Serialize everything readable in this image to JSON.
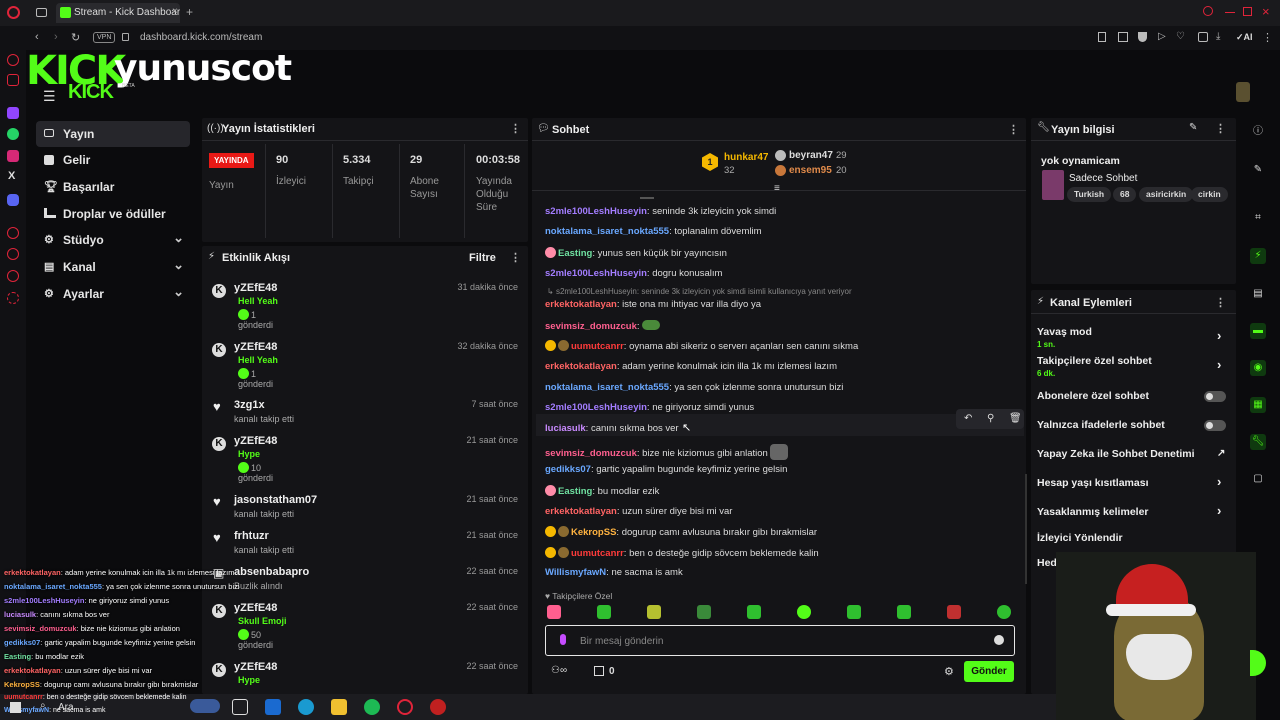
{
  "browser": {
    "tab_title": "Stream - Kick Dashboard",
    "url": "dashboard.kick.com/stream",
    "vpn": "VPN",
    "ai": "AI"
  },
  "header": {
    "logo": "KICK",
    "channel_name": "yunuscot",
    "sub_logo": "KICK",
    "beta": "BETA"
  },
  "nav": {
    "items": [
      {
        "label": "Yayın",
        "icon": "stream-icon"
      },
      {
        "label": "Gelir",
        "icon": "revenue-icon"
      },
      {
        "label": "Başarılar",
        "icon": "trophy-icon"
      },
      {
        "label": "Droplar ve ödüller",
        "icon": "drops-icon"
      },
      {
        "label": "Stüdyo",
        "icon": "studio-icon"
      },
      {
        "label": "Kanal",
        "icon": "channel-icon"
      },
      {
        "label": "Ayarlar",
        "icon": "settings-icon"
      }
    ]
  },
  "stats": {
    "title": "Yayın İstatistikleri",
    "status_badge": "YAYINDA",
    "status_label": "Yayın",
    "viewers": "90",
    "viewers_label": "İzleyici",
    "followers": "5.334",
    "followers_label": "Takipçi",
    "subs": "29",
    "subs_label1": "Abone",
    "subs_label2": "Sayısı",
    "uptime": "00:03:58",
    "uptime_label1": "Yayında",
    "uptime_label2": "Olduğu",
    "uptime_label3": "Süre"
  },
  "activity": {
    "title": "Etkinlik Akışı",
    "filter": "Filtre",
    "items": [
      {
        "user": "yZEfE48",
        "time": "31 dakika önce",
        "line1": "Hell Yeah",
        "count": "1",
        "line2": "gönderdi"
      },
      {
        "user": "yZEfE48",
        "time": "32 dakika önce",
        "line1": "Hell Yeah",
        "count": "1",
        "line2": "gönderdi"
      },
      {
        "user": "3zg1x",
        "time": "7 saat önce",
        "line2": "kanalı takip etti"
      },
      {
        "user": "yZEfE48",
        "time": "21 saat önce",
        "line1": "Hype",
        "count": "10",
        "line2": "gönderdi"
      },
      {
        "user": "jasonstatham07",
        "time": "21 saat önce",
        "line2": "kanalı takip etti"
      },
      {
        "user": "frhtuzr",
        "time": "21 saat önce",
        "line2": "kanalı takip etti"
      },
      {
        "user": "absenbabapro",
        "time": "22 saat önce",
        "line2": "Buzlik alındı"
      },
      {
        "user": "yZEfE48",
        "time": "22 saat önce",
        "line1": "Skull Emoji",
        "count": "50",
        "line2": "gönderdi"
      },
      {
        "user": "yZEfE48",
        "time": "22 saat önce",
        "line1": "Hype"
      }
    ]
  },
  "chat": {
    "title": "Sohbet",
    "top": [
      {
        "rank": "1",
        "user": "hunkar47",
        "count": "32"
      },
      {
        "user": "beyran47",
        "count": "29"
      },
      {
        "user": "ensem95",
        "count": "20"
      }
    ],
    "reply_note": "s2mle100LeshHuseyin: seninde 3k izleyicin yok simdi isimli kullanıcıya yanıt veriyor",
    "messages": [
      {
        "user": "s2mle100LeshHuseyin",
        "color": "#a37dff",
        "text": "seninde 3k izleyicin yok simdi"
      },
      {
        "user": "noktalama_isaret_nokta555",
        "color": "#6aa8ff",
        "text": "toplanalım dövemlim"
      },
      {
        "user": "Easting",
        "color": "#6fe0a0",
        "text": "yunus sen küçük bir yayıncısın"
      },
      {
        "user": "s2mle100LeshHuseyin",
        "color": "#a37dff",
        "text": "dogru konusalım"
      },
      {
        "user": "erkektokatlayan",
        "color": "#ff6464",
        "text": "iste ona mı ihtiyac var illa diyo ya"
      },
      {
        "user": "sevimsiz_domuzcuk",
        "color": "#ff5f8f",
        "text": ""
      },
      {
        "user": "uumutcanrr",
        "color": "#ff3b3b",
        "text": "oynama abi sikeriz o serverı açanları sen canını sıkma"
      },
      {
        "user": "erkektokatlayan",
        "color": "#ff6464",
        "text": "adam yerine konulmak icin illa 1k mı izlemesi lazım"
      },
      {
        "user": "noktalama_isaret_nokta555",
        "color": "#6aa8ff",
        "text": "ya sen çok izlenme sonra unutursun bizi"
      },
      {
        "user": "s2mle100LeshHuseyin",
        "color": "#a37dff",
        "text": "ne giriyoruz simdi yunus"
      },
      {
        "user": "luciasulk",
        "color": "#c98aff",
        "text": "canını sıkma bos ver"
      },
      {
        "user": "sevimsiz_domuzcuk",
        "color": "#ff5f8f",
        "text": "bize nie kiziomus gibi anlation"
      },
      {
        "user": "gedikks07",
        "color": "#6aa8ff",
        "text": "gartic yapalim bugunde keyfimiz yerine gelsin"
      },
      {
        "user": "Easting",
        "color": "#6fe0a0",
        "text": "bu modlar ezik"
      },
      {
        "user": "erkektokatlayan",
        "color": "#ff6464",
        "text": "uzun sürer diye bisi mi var"
      },
      {
        "user": "KekropSS",
        "color": "#ffb340",
        "text": "dogurup camı avlusuna bırakır gibı bırakmislar"
      },
      {
        "user": "uumutcanrr",
        "color": "#ff3b3b",
        "text": "ben o desteğe gidip sövcem beklemede kalin"
      },
      {
        "user": "WillismyfawN",
        "color": "#6aa8ff",
        "text": "ne sacma is amk"
      }
    ],
    "followers_only": "Takipçilere Özel",
    "input_placeholder": "Bir mesaj gönderin",
    "points": "0",
    "send": "Gönder"
  },
  "info": {
    "title": "Yayın bilgisi",
    "stream_title": "yok oynamicam",
    "category": "Sadece Sohbet",
    "tags": [
      "Turkish",
      "68",
      "asiricirkin",
      "cirkin"
    ]
  },
  "actions": {
    "title": "Kanal Eylemleri",
    "items": [
      {
        "label": "Yavaş mod",
        "sub": "1 sn.",
        "control": "chevron"
      },
      {
        "label": "Takipçilere özel sohbet",
        "sub": "6 dk.",
        "control": "chevron"
      },
      {
        "label": "Abonelere özel sohbet",
        "control": "toggle"
      },
      {
        "label": "Yalnızca ifadelerle sohbet",
        "control": "toggle"
      },
      {
        "label": "Yapay Zeka ile Sohbet Denetimi",
        "control": "external"
      },
      {
        "label": "Hesap yaşı kısıtlaması",
        "control": "chevron"
      },
      {
        "label": "Yasaklanmış kelimeler",
        "control": "chevron"
      },
      {
        "label": "İzleyici Yönlendir",
        "control": "none"
      },
      {
        "label": "Hed",
        "control": "none"
      }
    ]
  },
  "overlay_chat": [
    {
      "user": "erkektokatlayan",
      "color": "#ff6464",
      "text": "adam yerine konulmak icin illa 1k mı izlemesi lazım"
    },
    {
      "user": "noktalama_isaret_nokta555",
      "color": "#6aa8ff",
      "text": "ya sen çok izlenme sonra unutursun bizi"
    },
    {
      "user": "s2mle100LeshHuseyin",
      "color": "#a37dff",
      "text": "ne giriyoruz simdi yunus"
    },
    {
      "user": "luciasulk",
      "color": "#c98aff",
      "text": "canını sıkma bos ver"
    },
    {
      "user": "sevimsiz_domuzcuk",
      "color": "#ff5f8f",
      "text": "bize nie kiziomus gibi anlation"
    },
    {
      "user": "gedikks07",
      "color": "#6aa8ff",
      "text": "gartic yapalim bugunde keyfimiz yerine gelsin"
    },
    {
      "user": "Easting",
      "color": "#6fe0a0",
      "text": "bu modlar ezik"
    },
    {
      "user": "erkektokatlayan",
      "color": "#ff6464",
      "text": "uzun sürer diye bisi mi var"
    },
    {
      "user": "KekropSS",
      "color": "#ffb340",
      "text": "dogurup camı avlusuna bırakır gibı bırakmislar"
    },
    {
      "user": "uumutcanrr",
      "color": "#ff3b3b",
      "text": "ben o desteğe gidip sövcem beklemede kalin"
    },
    {
      "user": "WillismyfawN",
      "color": "#6aa8ff",
      "text": "ne sacma is amk"
    }
  ],
  "taskbar": {
    "search": "Ara"
  },
  "colors": {
    "accent": "#53fc18",
    "live": "#e91916",
    "panel": "#141417"
  }
}
